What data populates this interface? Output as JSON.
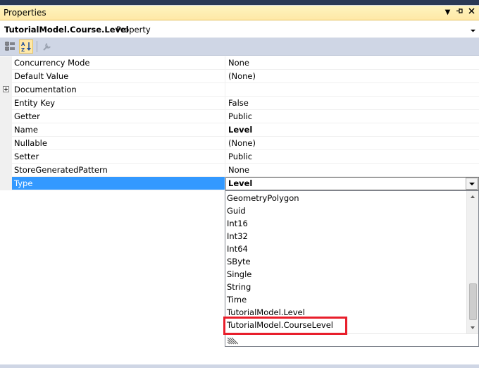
{
  "window": {
    "title": "Properties",
    "pin_glyph": "▾ ⊣ ✕"
  },
  "object_bar": {
    "name": "TutorialModel.Course.Level",
    "type": "Property"
  },
  "toolbar": {
    "buttons": [
      {
        "name": "categorized-icon",
        "active": false
      },
      {
        "name": "alphabetical-icon",
        "active": true
      },
      {
        "name": "property-pages-icon",
        "active": false
      }
    ]
  },
  "properties": [
    {
      "name": "Concurrency Mode",
      "value": "None"
    },
    {
      "name": "Default Value",
      "value": "(None)"
    },
    {
      "name": "Documentation",
      "value": "",
      "expandable": true
    },
    {
      "name": "Entity Key",
      "value": "False"
    },
    {
      "name": "Getter",
      "value": "Public"
    },
    {
      "name": "Name",
      "value": "Level",
      "bold": true
    },
    {
      "name": "Nullable",
      "value": "(None)"
    },
    {
      "name": "Setter",
      "value": "Public"
    },
    {
      "name": "StoreGeneratedPattern",
      "value": "None"
    },
    {
      "name": "Type",
      "value": "Level",
      "selected": true
    }
  ],
  "dropdown": {
    "items": [
      "GeometryPolygon",
      "Guid",
      "Int16",
      "Int32",
      "Int64",
      "SByte",
      "Single",
      "String",
      "Time",
      "TutorialModel.Level",
      "TutorialModel.CourseLevel"
    ],
    "highlighted_item": "TutorialModel.CourseLevel"
  },
  "colors": {
    "selection": "#3399ff",
    "title_bar": "#ffe8a6",
    "highlight_box": "#e81e2b"
  }
}
